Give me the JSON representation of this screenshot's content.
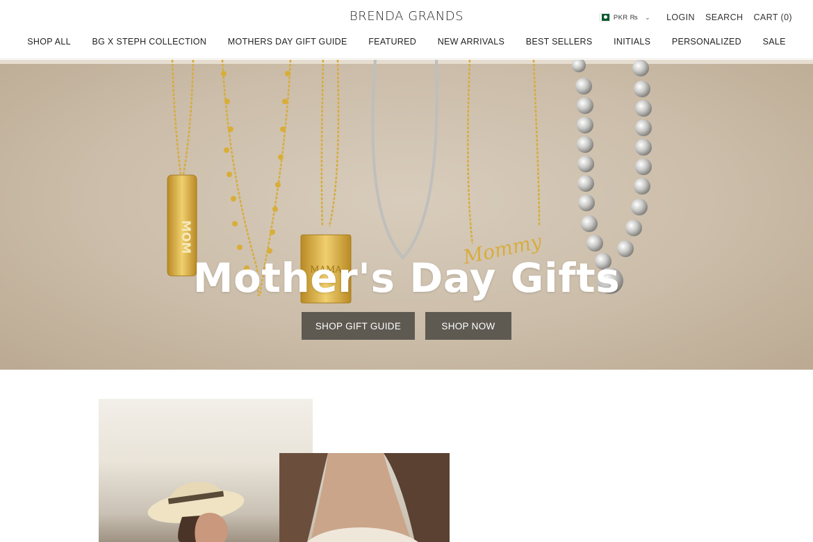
{
  "brand": {
    "logo_text": "BRENDA GRANDS"
  },
  "utility": {
    "currency_label": "PKR ₨",
    "currency_flag": "pakistan-flag-icon",
    "login": "LOGIN",
    "search": "SEARCH",
    "cart": "CART (0)"
  },
  "nav": {
    "items": [
      "SHOP ALL",
      "BG X STEPH COLLECTION",
      "MOTHERS DAY GIFT GUIDE",
      "FEATURED",
      "NEW ARRIVALS",
      "BEST SELLERS",
      "INITIALS",
      "PERSONALIZED",
      "SALE"
    ]
  },
  "hero": {
    "title": "Mother's Day Gifts",
    "button_gift_guide": "SHOP GIFT GUIDE",
    "button_shop_now": "SHOP NOW",
    "pendant_engravings": [
      "MOM",
      "MAMA",
      "Mommy"
    ]
  },
  "colors": {
    "hero_background": "#cbbda9",
    "button_background": "#5e5a52",
    "gold": "#d7ad3f",
    "silver": "#c9c9c7"
  }
}
